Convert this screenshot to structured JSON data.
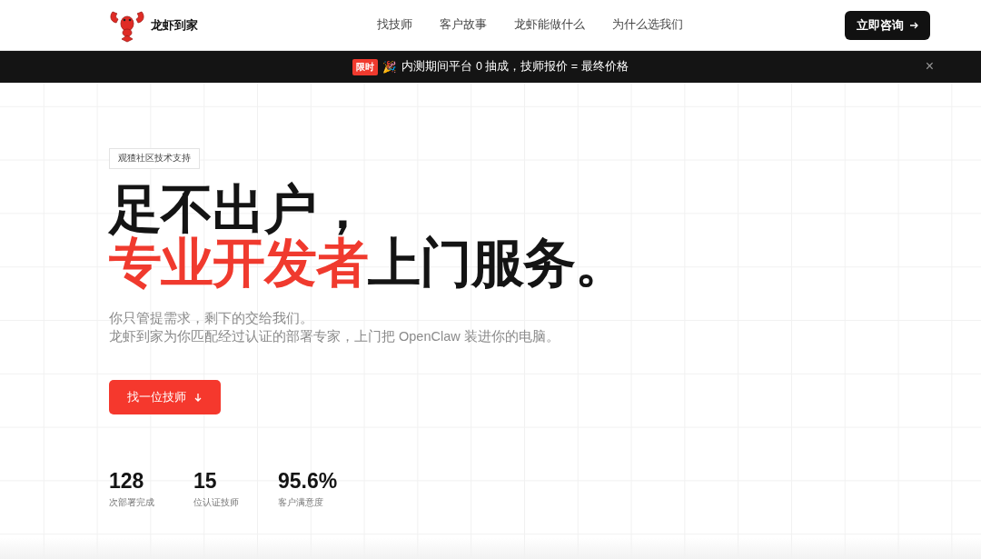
{
  "brand": {
    "name": "龙虾到家"
  },
  "nav": {
    "links": [
      "找技师",
      "客户故事",
      "龙虾能做什么",
      "为什么选我们"
    ],
    "cta": "立即咨询"
  },
  "announcement": {
    "tag": "限时",
    "emoji": "🎉",
    "text": "内测期间平台 0 抽成，技师报价 = 最终价格",
    "close": "×"
  },
  "hero": {
    "badge": "观猹社区技术支持",
    "heading_line1": "足不出户，",
    "heading_accent": "专业开发者",
    "heading_rest": "上门服务。",
    "lead": [
      "你只管提需求，剩下的交给我们。",
      "龙虾到家为你匹配经过认证的部署专家，上门把 OpenClaw 装进你的电脑。"
    ],
    "button": "找一位技师",
    "stats": [
      {
        "value": "128",
        "label": "次部署完成"
      },
      {
        "value": "15",
        "label": "位认证技师"
      },
      {
        "value": "95.6%",
        "label": "客户满意度"
      }
    ]
  }
}
